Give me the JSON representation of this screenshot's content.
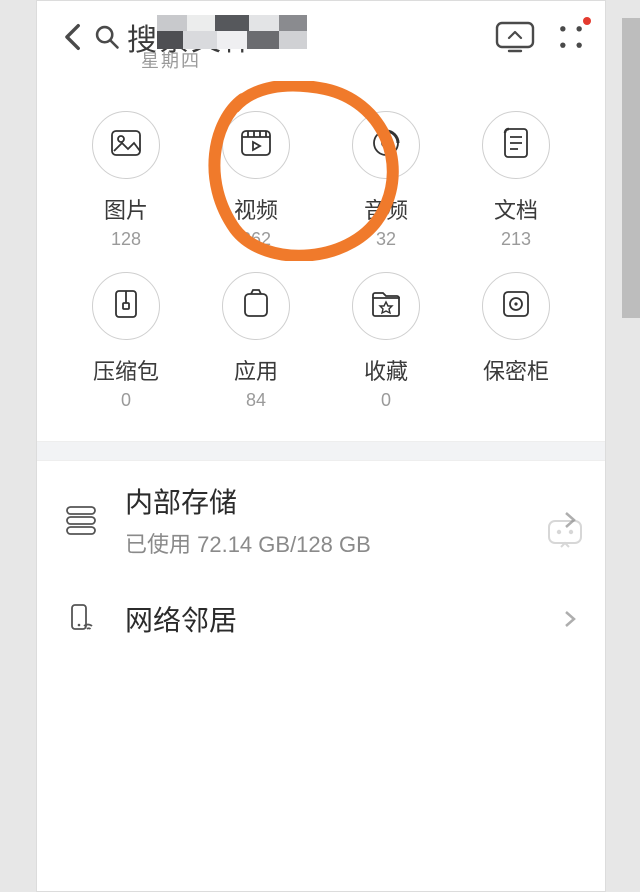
{
  "header": {
    "search_placeholder": "搜索文件",
    "weekday_hint": "星期四"
  },
  "categories": [
    {
      "key": "images",
      "label": "图片",
      "count": "128",
      "icon": "image-icon"
    },
    {
      "key": "videos",
      "label": "视频",
      "count": "362",
      "icon": "video-icon"
    },
    {
      "key": "audio",
      "label": "音频",
      "count": "32",
      "icon": "audio-icon"
    },
    {
      "key": "docs",
      "label": "文档",
      "count": "213",
      "icon": "document-icon"
    },
    {
      "key": "archives",
      "label": "压缩包",
      "count": "0",
      "icon": "archive-icon"
    },
    {
      "key": "apps",
      "label": "应用",
      "count": "84",
      "icon": "app-icon"
    },
    {
      "key": "fav",
      "label": "收藏",
      "count": "0",
      "icon": "favorite-icon"
    },
    {
      "key": "safe",
      "label": "保密柜",
      "count": "",
      "icon": "safe-icon"
    }
  ],
  "storage": {
    "title": "内部存储",
    "subtitle": "已使用 72.14 GB/128 GB"
  },
  "network": {
    "title": "网络邻居"
  },
  "annotation": {
    "highlighted_category_index": 1,
    "stroke_color": "#f07a2b"
  }
}
